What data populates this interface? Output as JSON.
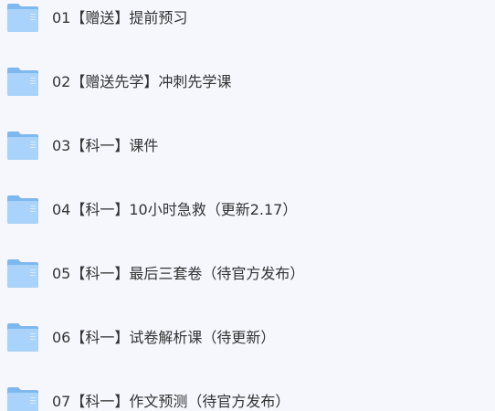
{
  "colors": {
    "background": "#f6f7fd",
    "text": "#333333",
    "folder_back": "#7fb8ee",
    "folder_front": "#a9d3fa"
  },
  "folders": [
    {
      "icon": "folder-icon",
      "label": "01【赠送】提前预习"
    },
    {
      "icon": "folder-icon",
      "label": "02【赠送先学】冲刺先学课"
    },
    {
      "icon": "folder-icon",
      "label": "03【科一】课件"
    },
    {
      "icon": "folder-icon",
      "label": "04【科一】10小时急救（更新2.17）"
    },
    {
      "icon": "folder-icon",
      "label": "05【科一】最后三套卷（待官方发布）"
    },
    {
      "icon": "folder-icon",
      "label": "06【科一】试卷解析课（待更新）"
    },
    {
      "icon": "folder-icon",
      "label": "07【科一】作文预测（待官方发布）"
    }
  ]
}
